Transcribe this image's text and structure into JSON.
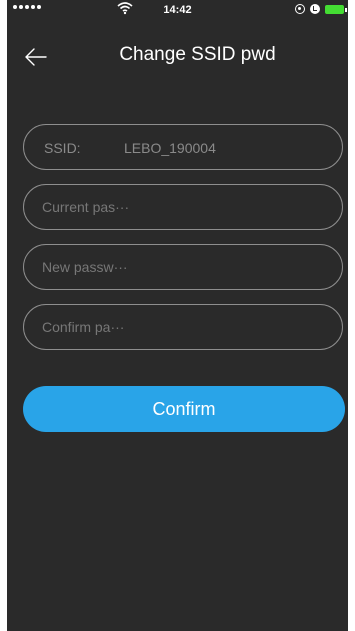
{
  "status_bar": {
    "time": "14:42",
    "battery_color": "#44dd33"
  },
  "header": {
    "title": "Change SSID pwd",
    "back_icon": "arrow-left-icon"
  },
  "form": {
    "ssid_label": "SSID:",
    "ssid_value": "LEBO_190004",
    "current_password_placeholder": "Current pas···",
    "new_password_placeholder": "New passw···",
    "confirm_password_placeholder": "Confirm pa···",
    "confirm_button_label": "Confirm",
    "accent_color": "#29a4e8"
  }
}
